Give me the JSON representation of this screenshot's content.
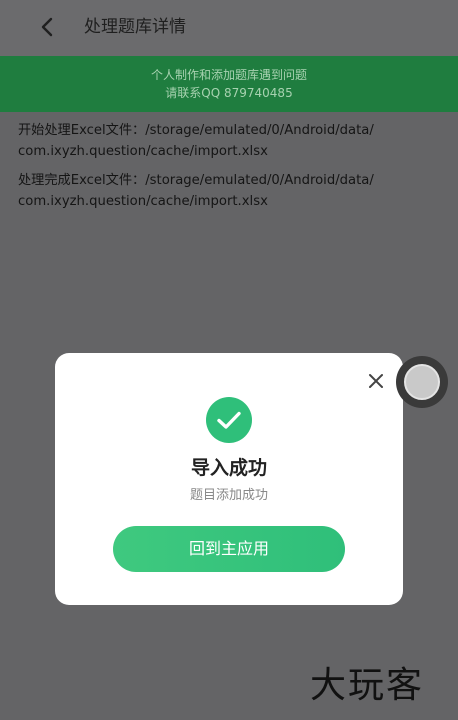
{
  "header": {
    "back_icon": "back-arrow-icon",
    "title": "处理题库详情"
  },
  "banner": {
    "line1": "个人制作和添加题库遇到问题",
    "line2": "请联系QQ 879740485"
  },
  "log": {
    "entries": [
      {
        "line1": "开始处理Excel文件：/storage/emulated/0/Android/data/",
        "line2": "com.ixyzh.question/cache/import.xlsx"
      },
      {
        "line1": "处理完成Excel文件：/storage/emulated/0/Android/data/",
        "line2": "com.ixyzh.question/cache/import.xlsx"
      }
    ]
  },
  "dialog": {
    "close_icon": "close-icon",
    "status_icon": "check-circle-icon",
    "title": "导入成功",
    "subtitle": "题目添加成功",
    "button_label": "回到主应用",
    "accent_color": "#2fbf7a"
  },
  "watermark": {
    "text": "大玩客"
  }
}
